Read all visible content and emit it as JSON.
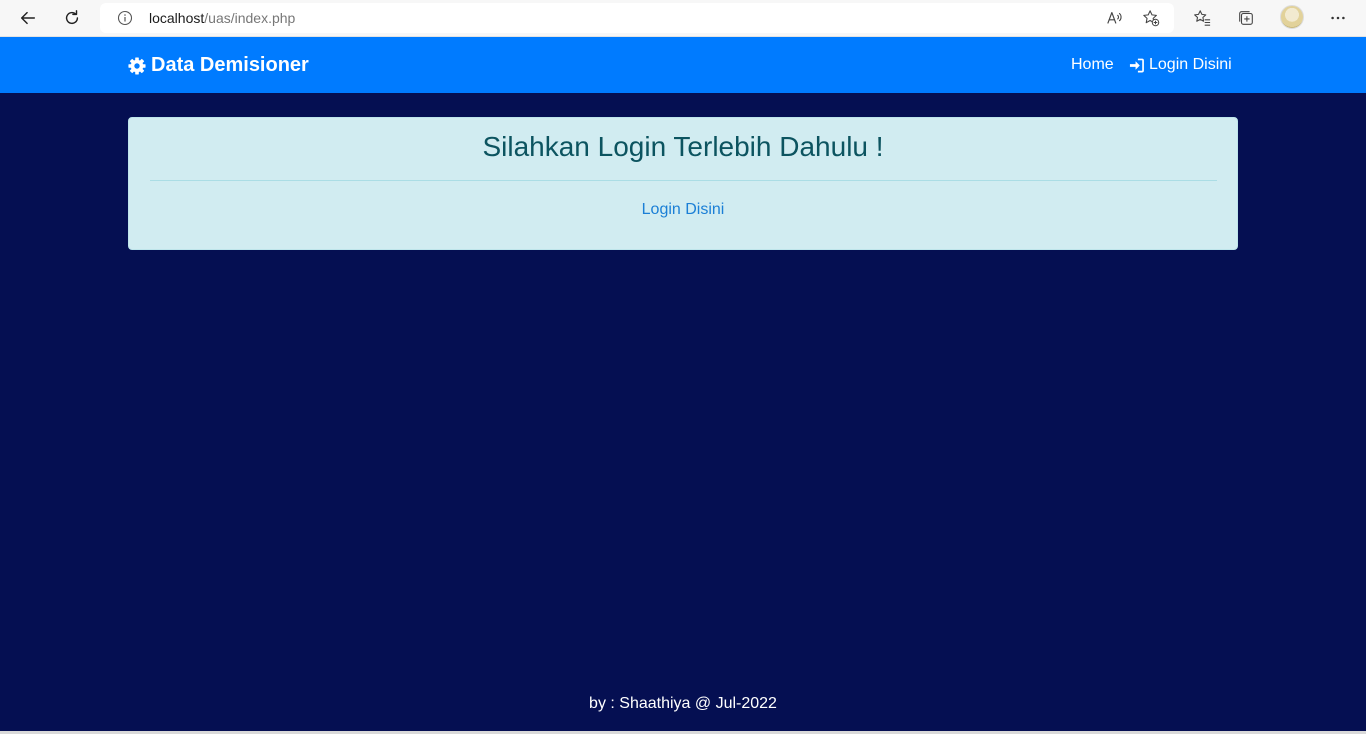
{
  "browser": {
    "url_host": "localhost",
    "url_path": "/uas/index.php"
  },
  "navbar": {
    "brand": "Data Demisioner",
    "home_label": "Home",
    "login_label": "Login Disini",
    "color": "#007bff"
  },
  "alert": {
    "heading": "Silahkan Login Terlebih Dahulu !",
    "link_label": "Login Disini",
    "background": "#d1ecf1"
  },
  "footer": {
    "text": "by : Shaathiya @ Jul-2022"
  },
  "colors": {
    "page_background": "#050f52",
    "heading_text": "#0c5460",
    "link_text": "#1b7fd6"
  },
  "icons": [
    "back-icon",
    "refresh-icon",
    "info-icon",
    "read-aloud-icon",
    "add-favorite-icon",
    "favorites-icon",
    "collections-icon",
    "more-icon",
    "gear-icon",
    "sign-in-icon"
  ]
}
